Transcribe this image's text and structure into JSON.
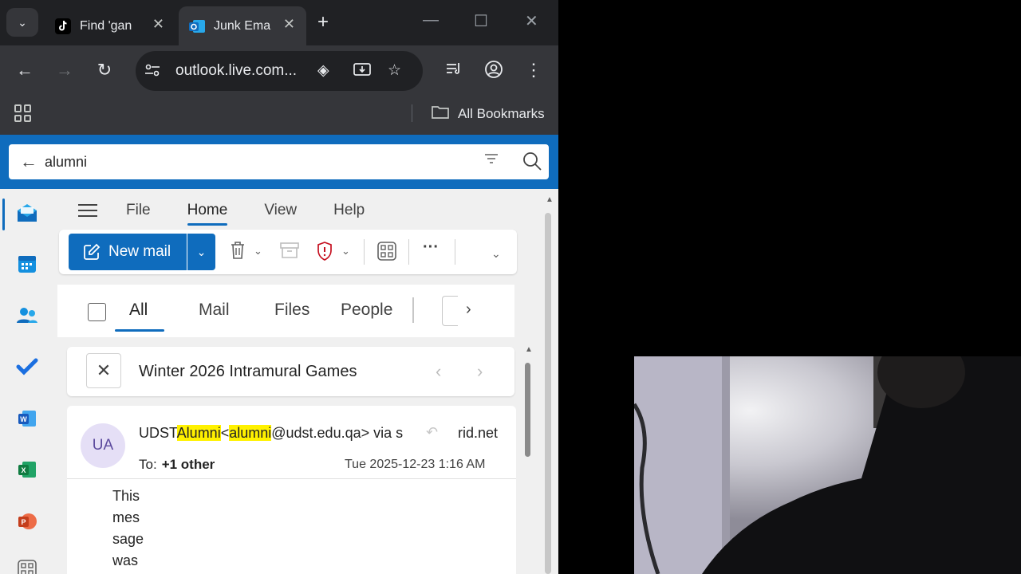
{
  "browser": {
    "tabs": [
      {
        "title": "Find 'gan",
        "active": false
      },
      {
        "title": "Junk Ema",
        "active": true
      }
    ],
    "address": "outlook.live.com...",
    "bookmarks_label": "All Bookmarks"
  },
  "search": {
    "query": "alumni"
  },
  "menu": {
    "items": [
      "File",
      "Home",
      "View",
      "Help"
    ],
    "active": "Home"
  },
  "ribbon": {
    "new_mail_label": "New mail",
    "more_label": "···"
  },
  "filters": {
    "pivots": [
      "All",
      "Mail",
      "Files",
      "People"
    ],
    "active": "All"
  },
  "thread": {
    "subject": "Winter 2026 Intramural Games"
  },
  "email": {
    "avatar_initials": "UA",
    "from_prefix": "UDST",
    "from_hl1": "Alumni",
    "from_mid": "<",
    "from_hl2": "alumni",
    "from_rest": "@udst.edu.qa> via s",
    "from_tail": "rid.net",
    "to_label": "To:",
    "to_value": "+1 other",
    "date": "Tue 2025-12-23 1:16 AM",
    "body": "This message was"
  },
  "colors": {
    "accent": "#0f6cbd",
    "highlight": "#fff100",
    "chrome_dark": "#202124",
    "chrome_toolbar": "#35363a"
  }
}
